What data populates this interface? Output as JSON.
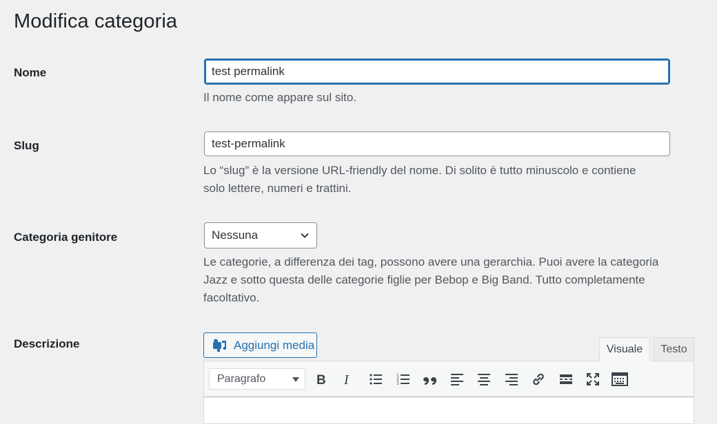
{
  "page": {
    "title": "Modifica categoria"
  },
  "name_field": {
    "label": "Nome",
    "value": "test permalink",
    "help": "Il nome come appare sul sito."
  },
  "slug_field": {
    "label": "Slug",
    "value": "test-permalink",
    "help_line1": "Lo “slug” è la versione URL-friendly del nome. Di solito è tutto minuscolo e contiene",
    "help_line2": "solo lettere, numeri e trattini."
  },
  "parent_field": {
    "label": "Categoria genitore",
    "selected": "Nessuna",
    "help_line1": "Le categorie, a differenza dei tag, possono avere una gerarchia. Puoi avere la categoria",
    "help_line2": "Jazz e sotto questa delle categorie figlie per Bebop e Big Band. Tutto completamente",
    "help_line3": "facoltativo."
  },
  "description_field": {
    "label": "Descrizione",
    "add_media_label": "Aggiungi media",
    "tabs": {
      "visual": "Visuale",
      "text": "Testo"
    },
    "format_select": "Paragrafo",
    "toolbar_icons": [
      "bold-icon",
      "italic-icon",
      "bullet-list-icon",
      "numbered-list-icon",
      "blockquote-icon",
      "align-left-icon",
      "align-center-icon",
      "align-right-icon",
      "link-icon",
      "read-more-icon",
      "fullscreen-icon",
      "toolbar-toggle-icon"
    ]
  },
  "colors": {
    "accent": "#2271b1",
    "background": "#f0f0f1",
    "help_text": "#50575e"
  }
}
